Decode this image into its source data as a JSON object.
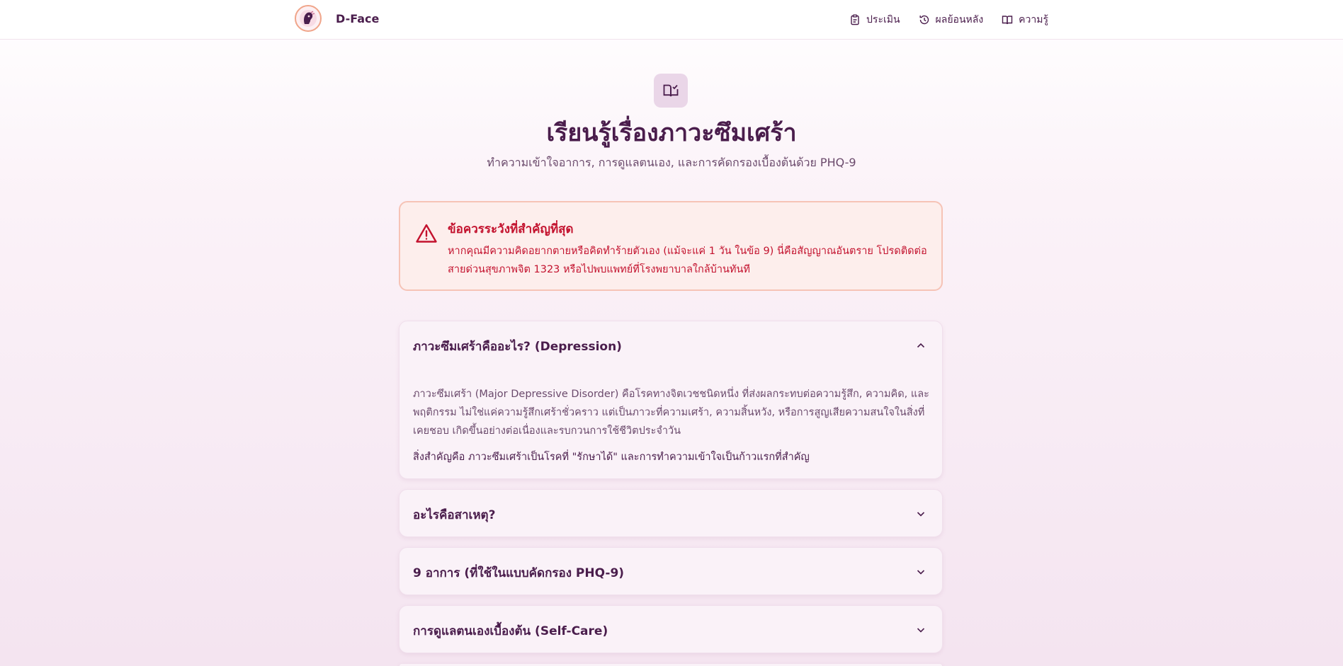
{
  "app": {
    "name": "D-Face"
  },
  "nav": {
    "items": [
      {
        "label": "ประเมิน",
        "icon": "clipboard-icon"
      },
      {
        "label": "ผลย้อนหลัง",
        "icon": "history-icon"
      },
      {
        "label": "ความรู้",
        "icon": "book-icon"
      }
    ]
  },
  "hero": {
    "icon": "book-check-icon",
    "title": "เรียนรู้เรื่องภาวะซึมเศร้า",
    "subtitle": "ทำความเข้าใจอาการ, การดูแลตนเอง, และการคัดกรองเบื้องต้นด้วย PHQ-9"
  },
  "alert": {
    "icon": "warning-icon",
    "title": "ข้อควรระวังที่สำคัญที่สุด",
    "body": "หากคุณมีความคิดอยากตายหรือคิดทำร้ายตัวเอง (แม้จะแค่ 1 วัน ในข้อ 9) นี่คือสัญญาณอันตราย โปรดติดต่อสายด่วนสุขภาพจิต 1323 หรือไปพบแพทย์ที่โรงพยาบาลใกล้บ้านทันที"
  },
  "sections": [
    {
      "title": "ภาวะซึมเศร้าคืออะไร? (Depression)",
      "expanded": true,
      "paragraph1": "ภาวะซึมเศร้า (Major Depressive Disorder) คือโรคทางจิตเวชชนิดหนึ่ง ที่ส่งผลกระทบต่อความรู้สึก, ความคิด, และพฤติกรรม ไม่ใช่แค่ความรู้สึกเศร้าชั่วคราว แต่เป็นภาวะที่ความเศร้า, ความสิ้นหวัง, หรือการสูญเสียความสนใจในสิ่งที่เคยชอบ เกิดขึ้นอย่างต่อเนื่องและรบกวนการใช้ชีวิตประจำวัน",
      "paragraph2": "สิ่งสำคัญคือ ภาวะซึมเศร้าเป็นโรคที่ \"รักษาได้\" และการทำความเข้าใจเป็นก้าวแรกที่สำคัญ"
    },
    {
      "title": "อะไรคือสาเหตุ?",
      "expanded": false
    },
    {
      "title": "9 อาการ (ที่ใช้ในแบบคัดกรอง PHQ-9)",
      "expanded": false
    },
    {
      "title": "การดูแลตนเองเบื้องต้น (Self-Care)",
      "expanded": false
    }
  ],
  "colors": {
    "primary": "#4a1d4c",
    "alert_text": "#c3122e",
    "alert_bg": "#fdeeec",
    "alert_border": "#f6c3b6"
  }
}
